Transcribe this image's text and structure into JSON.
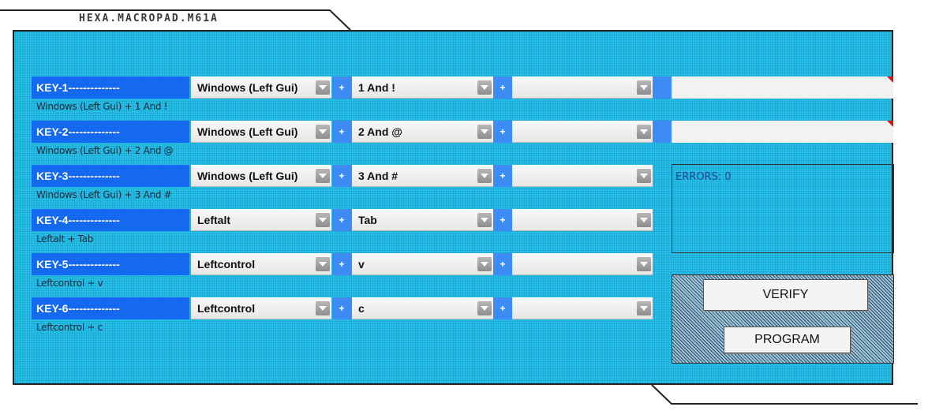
{
  "app": {
    "title": "HEXA.MACROPAD.M61A"
  },
  "keys": [
    {
      "label": "KEY-1--------------",
      "mod": "Windows (Left Gui)",
      "key1": "1 And !",
      "key2": "",
      "summary": "Windows (Left Gui) + 1 And !"
    },
    {
      "label": "KEY-2--------------",
      "mod": "Windows (Left Gui)",
      "key1": "2 And @",
      "key2": "",
      "summary": "Windows (Left Gui) + 2 And @"
    },
    {
      "label": "KEY-3--------------",
      "mod": "Windows (Left Gui)",
      "key1": "3 And #",
      "key2": "",
      "summary": "Windows (Left Gui) + 3 And #"
    },
    {
      "label": "KEY-4--------------",
      "mod": "Leftalt",
      "key1": "Tab",
      "key2": "",
      "summary": "Leftalt + Tab"
    },
    {
      "label": "KEY-5--------------",
      "mod": "Leftcontrol",
      "key1": "v",
      "key2": "",
      "summary": "Leftcontrol + v"
    },
    {
      "label": "KEY-6--------------",
      "mod": "Leftcontrol",
      "key1": "c",
      "key2": "",
      "summary": "Leftcontrol + c"
    }
  ],
  "plus_symbol": "+",
  "errors": {
    "text": "ERRORS: 0"
  },
  "buttons": {
    "verify": "VERIFY",
    "program": "PROGRAM"
  },
  "colors": {
    "panel": "#27c0ea",
    "key_label_bg": "#1568f0",
    "plus_bg": "#3d8cf5"
  }
}
